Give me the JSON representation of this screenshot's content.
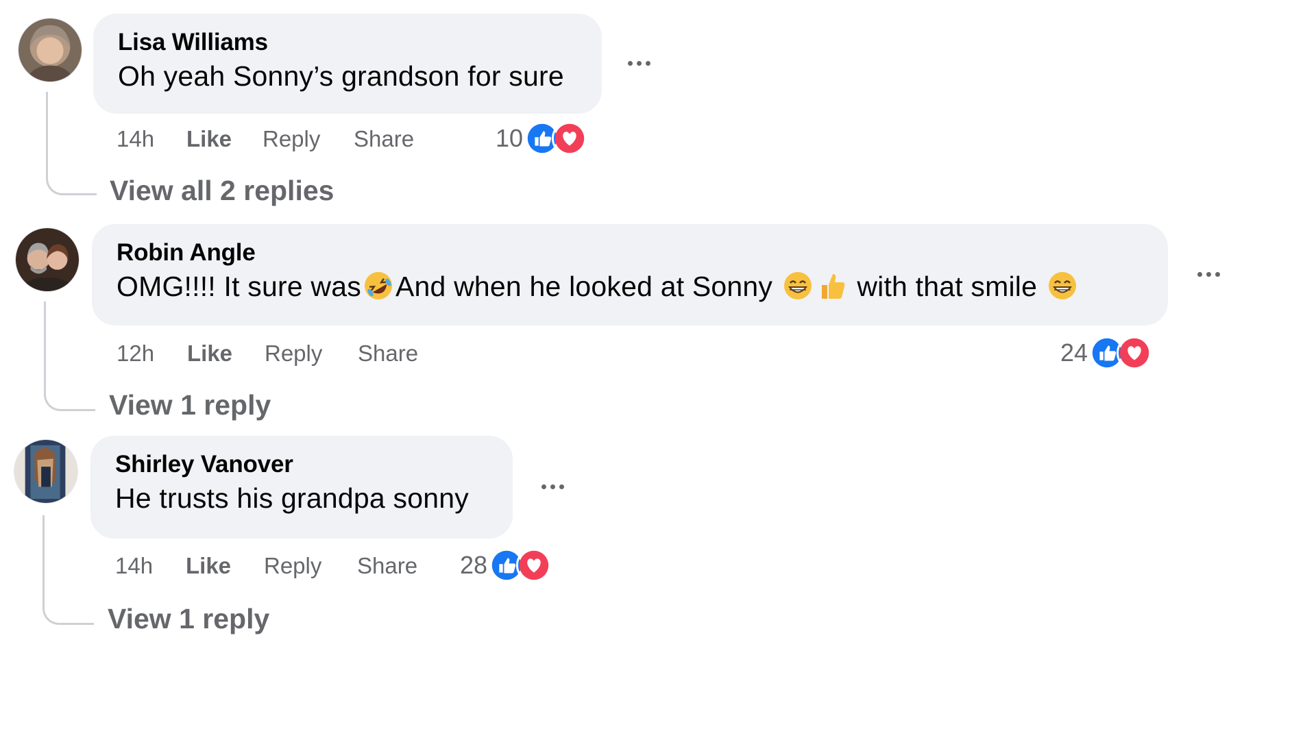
{
  "comments": [
    {
      "author": "Lisa Williams",
      "text_parts": [
        "Oh yeah Sonny’s grandson for sure"
      ],
      "time": "14h",
      "like_label": "Like",
      "reply_label": "Reply",
      "share_label": "Share",
      "reaction_count": "10",
      "reaction_icons": [
        "like-icon",
        "love-icon"
      ],
      "view_replies": "View all 2 replies"
    },
    {
      "author": "Robin Angle",
      "text_parts": [
        "OMG!!!! It sure was",
        "And when he looked at Sonny",
        "with that smile"
      ],
      "emojis": [
        "rolling-on-floor-laughing-emoji",
        "grinning-squinting-emoji",
        "thumbs-up-emoji",
        "grinning-squinting-emoji"
      ],
      "time": "12h",
      "like_label": "Like",
      "reply_label": "Reply",
      "share_label": "Share",
      "reaction_count": "24",
      "reaction_icons": [
        "like-icon",
        "love-icon"
      ],
      "view_replies": "View 1 reply"
    },
    {
      "author": "Shirley Vanover",
      "text_parts": [
        "He trusts his grandpa sonny"
      ],
      "time": "14h",
      "like_label": "Like",
      "reply_label": "Reply",
      "share_label": "Share",
      "reaction_count": "28",
      "reaction_icons": [
        "like-icon",
        "love-icon"
      ],
      "view_replies": "View 1 reply"
    }
  ],
  "colors": {
    "bubble_bg": "#f0f2f5",
    "secondary_text": "#65676b",
    "like_blue": "#1877f2",
    "love_red": "#f33e58"
  }
}
